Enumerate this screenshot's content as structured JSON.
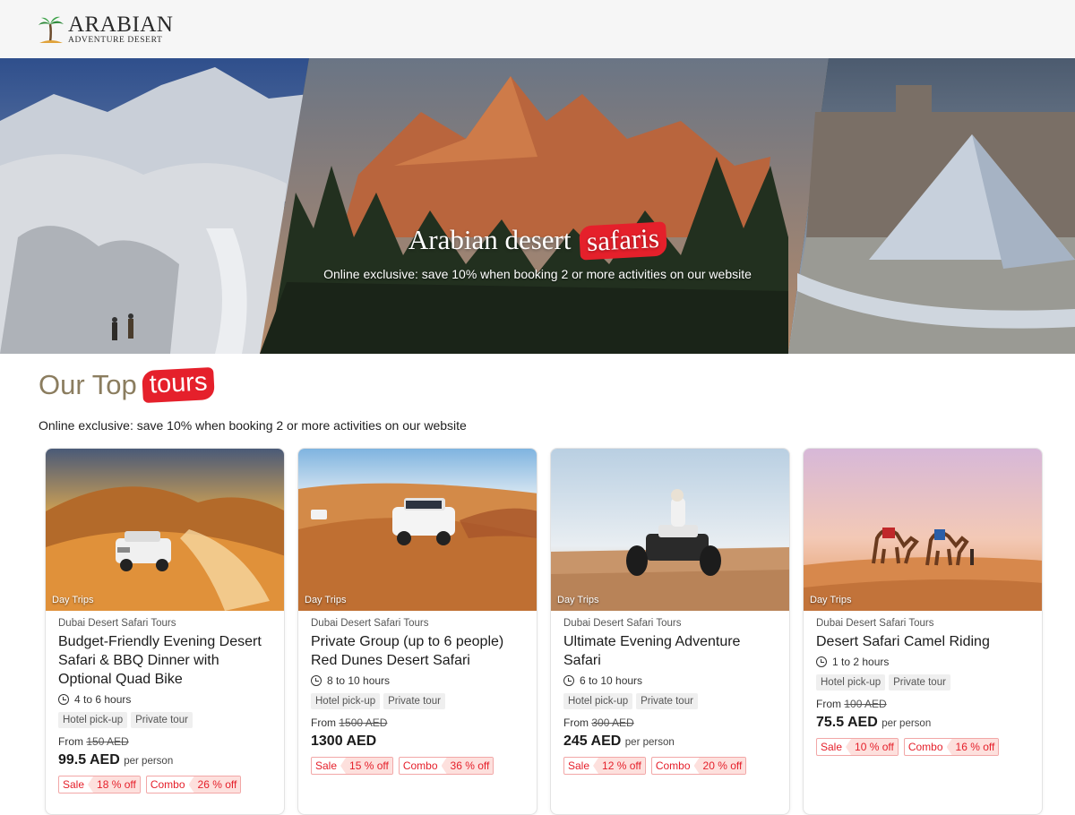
{
  "brand": {
    "name": "ARABIAN",
    "tagline": "ADVENTURE DESERT"
  },
  "hero": {
    "title_prefix": "Arabian desert",
    "title_highlight": "safaris",
    "subtitle": "Online exclusive: save 10% when booking 2 or more activities on our website"
  },
  "section": {
    "title_prefix": "Our Top",
    "title_highlight": "tours",
    "subtitle": "Online exclusive: save 10% when booking 2 or more activities on our website"
  },
  "tours": [
    {
      "category": "Day Trips",
      "provider": "Dubai Desert Safari Tours",
      "title": "Budget-Friendly Evening Desert Safari & BBQ Dinner with Optional Quad Bike",
      "duration": "4 to 6 hours",
      "tags": [
        "Hotel pick-up",
        "Private tour"
      ],
      "from_label": "From",
      "old_price": "150 AED",
      "price": "99.5 AED",
      "per": "per person",
      "badges": [
        {
          "label": "Sale",
          "value": "18 % off"
        },
        {
          "label": "Combo",
          "value": "26 % off"
        }
      ]
    },
    {
      "category": "Day Trips",
      "provider": "Dubai Desert Safari Tours",
      "title": "Private Group (up to 6 people) Red Dunes Desert Safari",
      "duration": "8 to 10 hours",
      "tags": [
        "Hotel pick-up",
        "Private tour"
      ],
      "from_label": "From",
      "old_price": "1500 AED",
      "price": "1300 AED",
      "per": "",
      "badges": [
        {
          "label": "Sale",
          "value": "15 % off"
        },
        {
          "label": "Combo",
          "value": "36 % off"
        }
      ]
    },
    {
      "category": "Day Trips",
      "provider": "Dubai Desert Safari Tours",
      "title": "Ultimate Evening Adventure Safari",
      "duration": "6 to 10 hours",
      "tags": [
        "Hotel pick-up",
        "Private tour"
      ],
      "from_label": "From",
      "old_price": "300 AED",
      "price": "245 AED",
      "per": "per person",
      "badges": [
        {
          "label": "Sale",
          "value": "12 % off"
        },
        {
          "label": "Combo",
          "value": "20 % off"
        }
      ]
    },
    {
      "category": "Day Trips",
      "provider": "Dubai Desert Safari Tours",
      "title": "Desert Safari Camel Riding",
      "duration": "1 to 2 hours",
      "tags": [
        "Hotel pick-up",
        "Private tour"
      ],
      "from_label": "From",
      "old_price": "100 AED",
      "price": "75.5 AED",
      "per": "per person",
      "badges": [
        {
          "label": "Sale",
          "value": "10 % off"
        },
        {
          "label": "Combo",
          "value": "16 % off"
        }
      ]
    }
  ],
  "colors": {
    "accent": "#e5202b",
    "section_title": "#8b7d5f",
    "badge_bg": "#fde0dd"
  },
  "icons": {
    "duration": "clock-icon",
    "logo": "palm-tree-icon"
  }
}
